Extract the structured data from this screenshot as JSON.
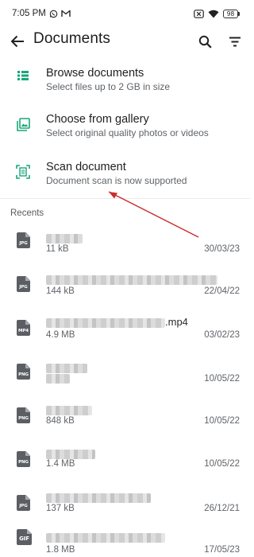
{
  "status_bar": {
    "time": "7:05 PM",
    "battery": "98",
    "icons": [
      "whatsapp-icon",
      "gmail-icon",
      "close-box-icon",
      "wifi-icon",
      "battery-icon"
    ]
  },
  "app_bar": {
    "title": "Documents",
    "icons": [
      "back-arrow-icon",
      "search-icon",
      "sort-icon"
    ]
  },
  "options": [
    {
      "title": "Browse documents",
      "subtitle": "Select files up to 2 GB in size",
      "icon": "list-icon"
    },
    {
      "title": "Choose from gallery",
      "subtitle": "Select original quality photos or videos",
      "icon": "gallery-icon"
    },
    {
      "title": "Scan document",
      "subtitle": "Document scan is now supported",
      "icon": "scan-icon"
    }
  ],
  "colors": {
    "accent_green": "#1aa67a",
    "annotation_arrow": "#cc2b2b",
    "file_icon_gray": "#5b5e63"
  },
  "recents": {
    "header": "Recents",
    "files": [
      {
        "type": "JPG",
        "name_visible": "",
        "size": "11 kB",
        "date": "30/03/23"
      },
      {
        "type": "JPG",
        "name_visible": "",
        "size": "144 kB",
        "date": "22/04/22"
      },
      {
        "type": "MP4",
        "name_visible": ".mp4",
        "size": "4.9 MB",
        "date": "03/02/23"
      },
      {
        "type": "PNG",
        "name_visible": "",
        "size": "",
        "date": "10/05/22"
      },
      {
        "type": "PNG",
        "name_visible": "",
        "size": "848 kB",
        "date": "10/05/22"
      },
      {
        "type": "PNG",
        "name_visible": "",
        "size": "1.4 MB",
        "date": "10/05/22"
      },
      {
        "type": "JPG",
        "name_visible": "",
        "size": "137 kB",
        "date": "26/12/21"
      },
      {
        "type": "GIF",
        "name_visible": "",
        "size": "1.8 MB",
        "date": "17/05/23"
      }
    ]
  }
}
